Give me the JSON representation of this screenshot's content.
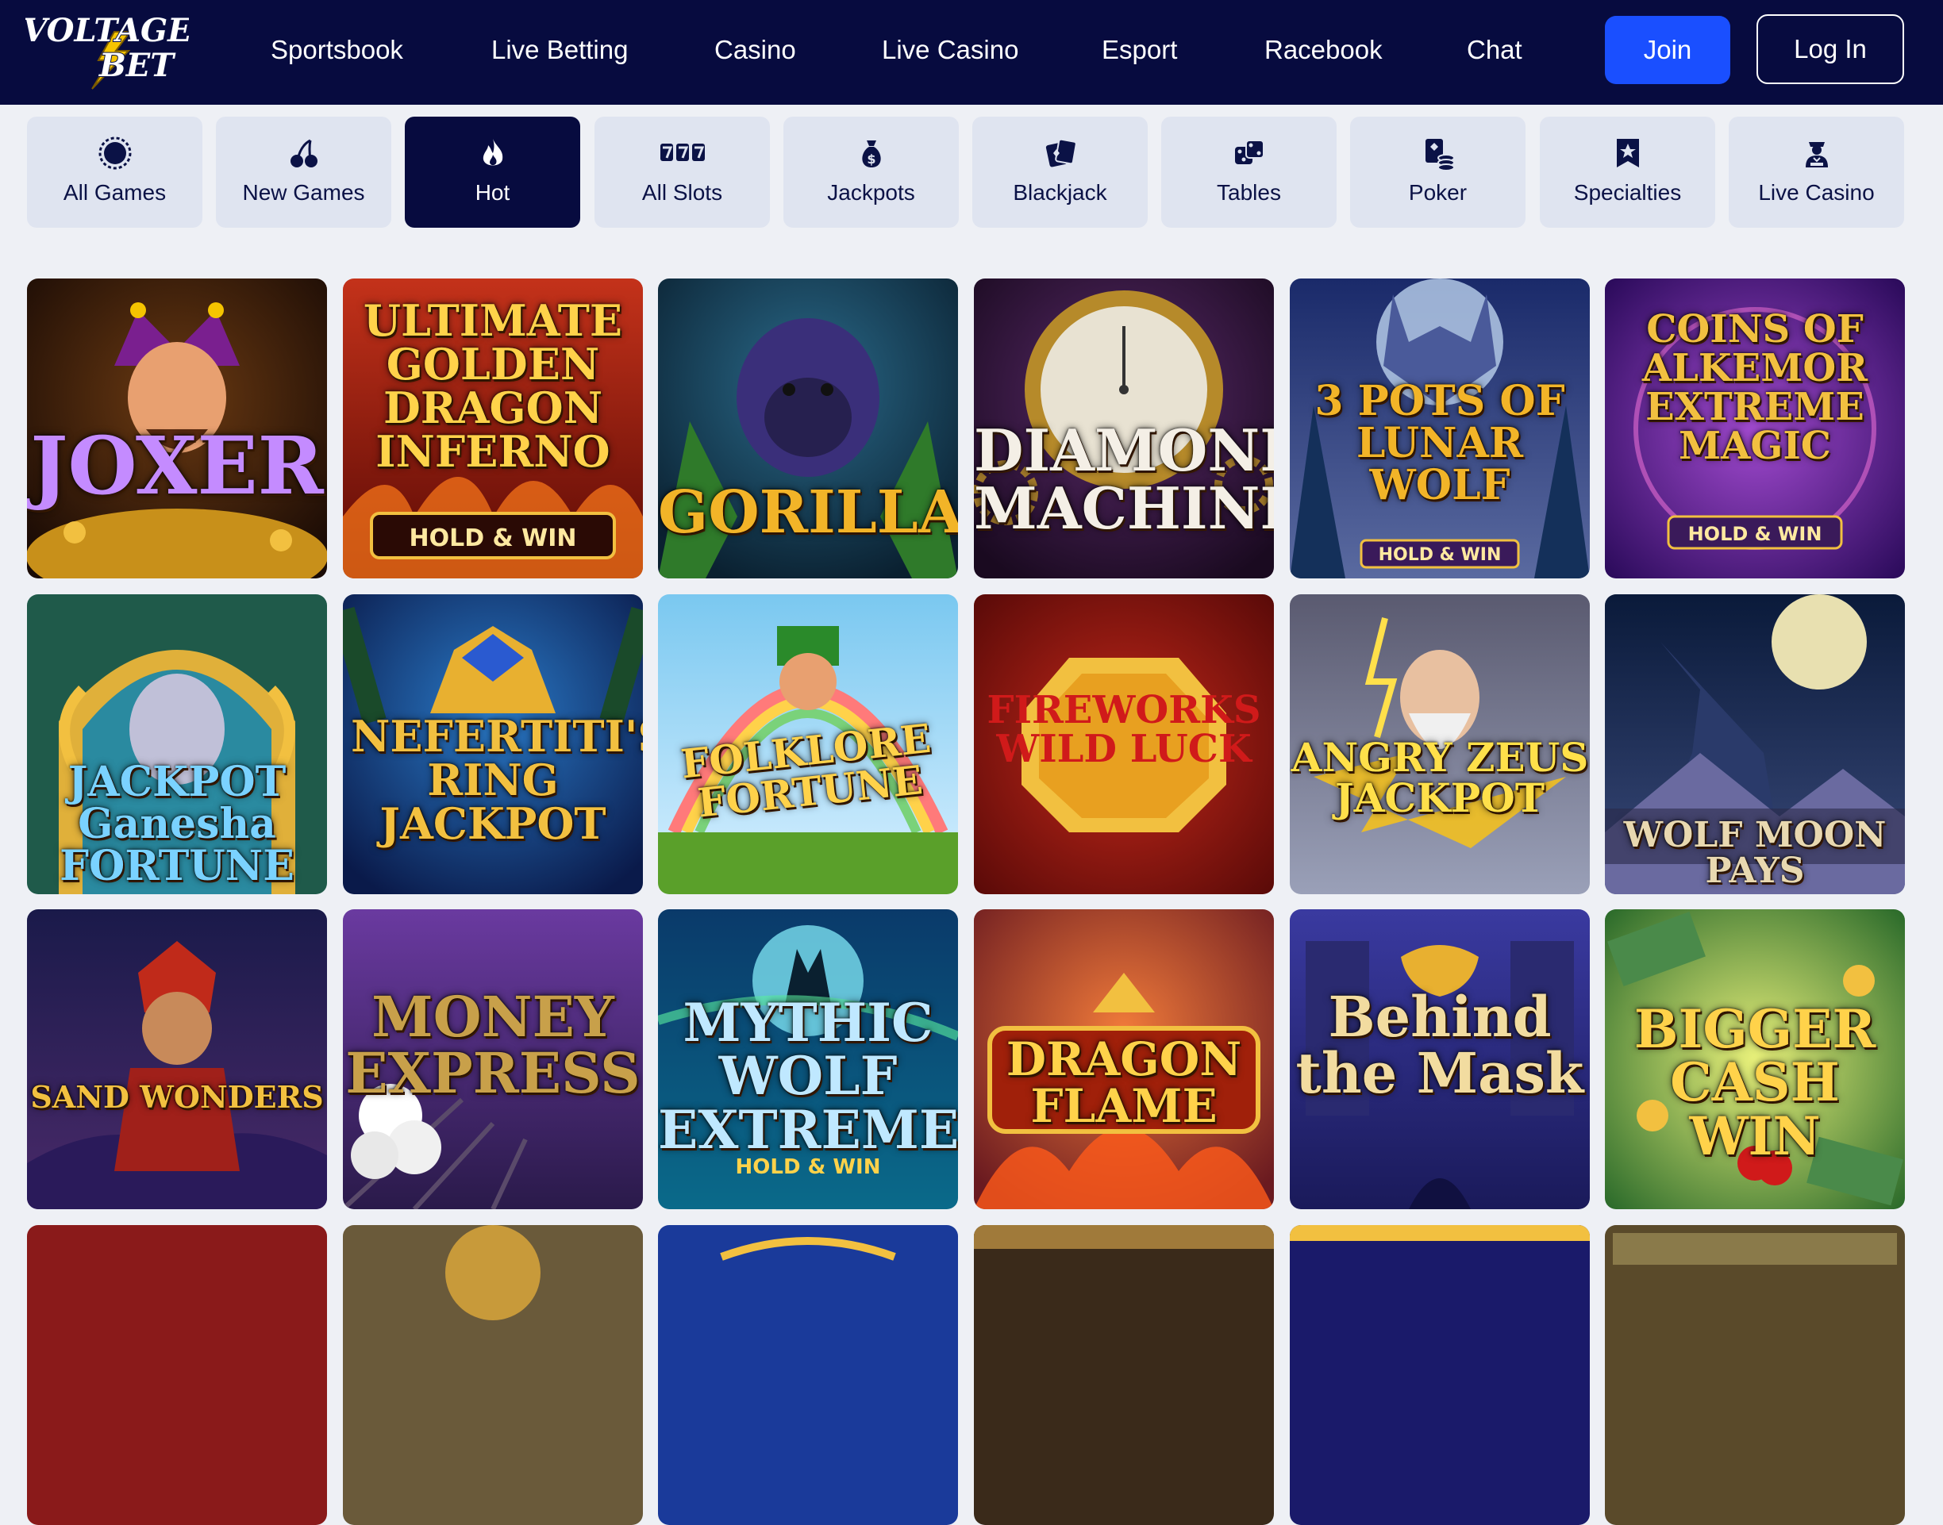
{
  "brand": {
    "logo_line1": "VOLTAGE",
    "logo_line2": "BET"
  },
  "nav": [
    "Sportsbook",
    "Live Betting",
    "Casino",
    "Live Casino",
    "Esport",
    "Racebook",
    "Chat"
  ],
  "auth": {
    "join": "Join",
    "login": "Log In"
  },
  "categories": [
    {
      "label": "All Games",
      "icon": "globe-icon"
    },
    {
      "label": "New Games",
      "icon": "cherries-icon"
    },
    {
      "label": "Hot",
      "icon": "flame-icon",
      "active": true
    },
    {
      "label": "All Slots",
      "icon": "sevens-icon"
    },
    {
      "label": "Jackpots",
      "icon": "money-bag-icon"
    },
    {
      "label": "Blackjack",
      "icon": "cards-icon"
    },
    {
      "label": "Tables",
      "icon": "dice-icon"
    },
    {
      "label": "Poker",
      "icon": "poker-chips-icon"
    },
    {
      "label": "Specialties",
      "icon": "star-bookmark-icon"
    },
    {
      "label": "Live Casino",
      "icon": "dealer-icon"
    }
  ],
  "games": [
    {
      "title": "JOXER",
      "sub": ""
    },
    {
      "title": "ULTIMATE GOLDEN DRAGON INFERNO",
      "sub": "HOLD & WIN"
    },
    {
      "title": "GORILLA",
      "sub": ""
    },
    {
      "title": "DIAMOND MACHINE",
      "sub": ""
    },
    {
      "title": "3 POTS OF LUNAR WOLF",
      "sub": "HOLD & WIN"
    },
    {
      "title": "COINS OF ALKEMOR EXTREME MAGIC",
      "sub": "HOLD & WIN"
    },
    {
      "title": "JACKPOT Ganesha FORTUNE",
      "sub": ""
    },
    {
      "title": "NEFERTITI'S RING JACKPOT",
      "sub": ""
    },
    {
      "title": "FOLKLORE FORTUNE",
      "sub": ""
    },
    {
      "title": "FIREWORKS WILD LUCK",
      "sub": ""
    },
    {
      "title": "ANGRY ZEUS JACKPOT",
      "sub": ""
    },
    {
      "title": "WOLF MOON PAYS",
      "sub": ""
    },
    {
      "title": "SAND WONDERS",
      "sub": ""
    },
    {
      "title": "MONEY EXPRESS",
      "sub": ""
    },
    {
      "title": "MYTHIC WOLF EXTREME",
      "sub": "HOLD & WIN"
    },
    {
      "title": "DRAGON FLAME",
      "sub": ""
    },
    {
      "title": "Behind the Mask",
      "sub": ""
    },
    {
      "title": "BIGGER CASH WIN",
      "sub": ""
    }
  ],
  "colors": {
    "nav_bg": "#070b3f",
    "join_bg": "#1a4fff",
    "category_bg": "#dfe4f0",
    "category_active_bg": "#070b3f",
    "page_bg": "#eef0f5"
  }
}
